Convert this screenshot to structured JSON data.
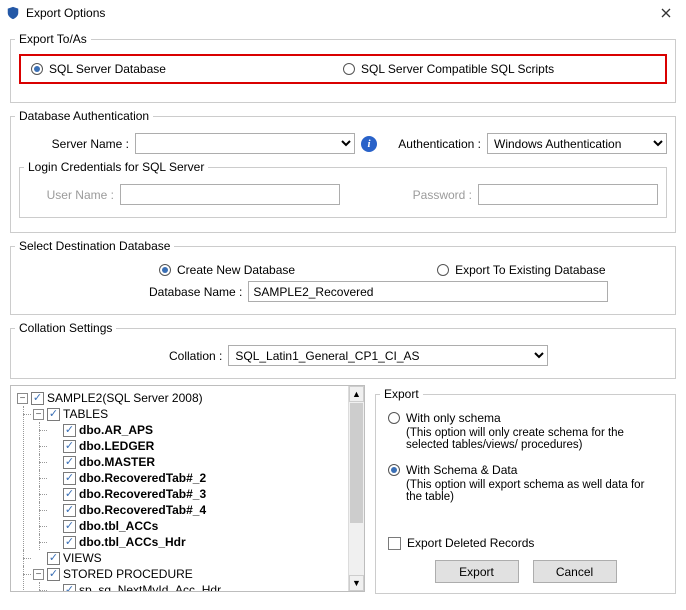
{
  "window": {
    "title": "Export Options"
  },
  "export_to_as": {
    "legend": "Export To/As",
    "opt1": "SQL Server Database",
    "opt2": "SQL Server Compatible SQL Scripts"
  },
  "db_auth": {
    "legend": "Database Authentication",
    "server_label": "Server Name :",
    "server_value": "",
    "auth_label": "Authentication :",
    "auth_value": "Windows Authentication",
    "login_legend": "Login Credentials for SQL Server",
    "user_label": "User Name :",
    "user_value": "",
    "pass_label": "Password :",
    "pass_value": ""
  },
  "dest_db": {
    "legend": "Select Destination Database",
    "opt1": "Create New Database",
    "opt2": "Export To Existing Database",
    "name_label": "Database Name :",
    "name_value": "SAMPLE2_Recovered"
  },
  "collation": {
    "legend": "Collation Settings",
    "label": "Collation :",
    "value": "SQL_Latin1_General_CP1_CI_AS"
  },
  "tree": {
    "root": "SAMPLE2(SQL Server 2008)",
    "tables_label": "TABLES",
    "tables": [
      "dbo.AR_APS",
      "dbo.LEDGER",
      "dbo.MASTER",
      "dbo.RecoveredTab#_2",
      "dbo.RecoveredTab#_3",
      "dbo.RecoveredTab#_4",
      "dbo.tbl_ACCs",
      "dbo.tbl_ACCs_Hdr"
    ],
    "views_label": "VIEWS",
    "sp_label": "STORED PROCEDURE",
    "sp_items": [
      "sp_sg_NextMyId_Acc_Hdr"
    ]
  },
  "export_opts": {
    "legend": "Export",
    "opt1": "With only schema",
    "hint1": "(This option will only create schema for the  selected tables/views/ procedures)",
    "opt2": "With Schema & Data",
    "hint2": "(This option will export schema as well data for the table)",
    "deleted": "Export Deleted Records",
    "btn_export": "Export",
    "btn_cancel": "Cancel"
  }
}
